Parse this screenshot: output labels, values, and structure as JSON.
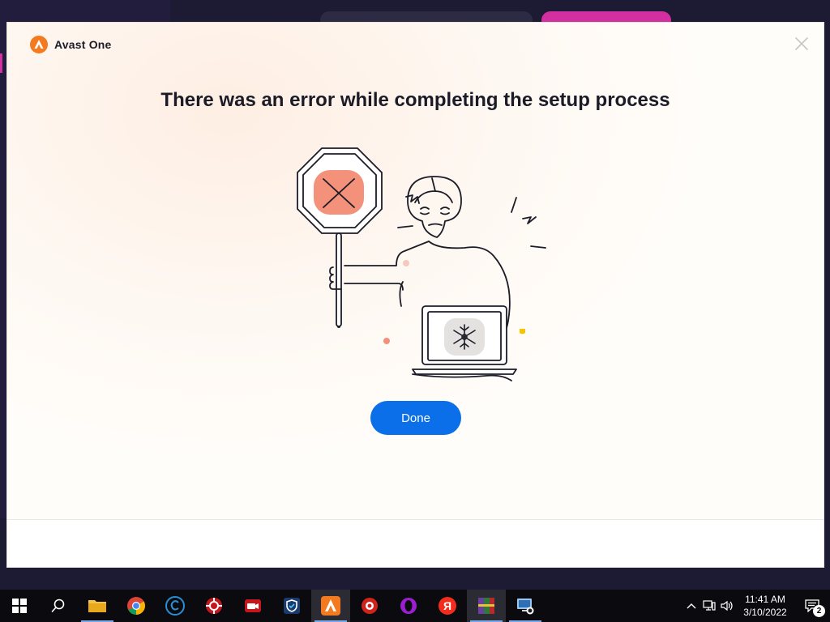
{
  "dialog": {
    "brand_name": "Avast One",
    "title": "There was an error while completing the setup process",
    "done_label": "Done"
  },
  "taskbar": {
    "apps": [
      {
        "name": "start-button",
        "icon": "windows-logo-icon"
      },
      {
        "name": "search-button",
        "icon": "search-icon"
      },
      {
        "name": "file-explorer",
        "icon": "folder-icon"
      },
      {
        "name": "chrome",
        "icon": "chrome-icon"
      },
      {
        "name": "ccleaner",
        "icon": "ccleaner-icon"
      },
      {
        "name": "app-red-gear",
        "icon": "red-gear-icon"
      },
      {
        "name": "screen-recorder",
        "icon": "video-camera-icon"
      },
      {
        "name": "shield-app",
        "icon": "shield-icon"
      },
      {
        "name": "avast-one",
        "icon": "avast-icon",
        "active": true
      },
      {
        "name": "app-red-circle",
        "icon": "red-circle-icon"
      },
      {
        "name": "opera",
        "icon": "opera-icon"
      },
      {
        "name": "yandex",
        "icon": "yandex-icon"
      },
      {
        "name": "winrar",
        "icon": "winrar-icon"
      },
      {
        "name": "remote-desktop",
        "icon": "monitor-icon"
      }
    ],
    "time": "11:41 AM",
    "date": "3/10/2022",
    "notification_count": "2"
  },
  "colors": {
    "accent_button": "#0a6fe8",
    "brand_orange": "#f47a20",
    "stop_sign_fill": "#f4917a"
  }
}
